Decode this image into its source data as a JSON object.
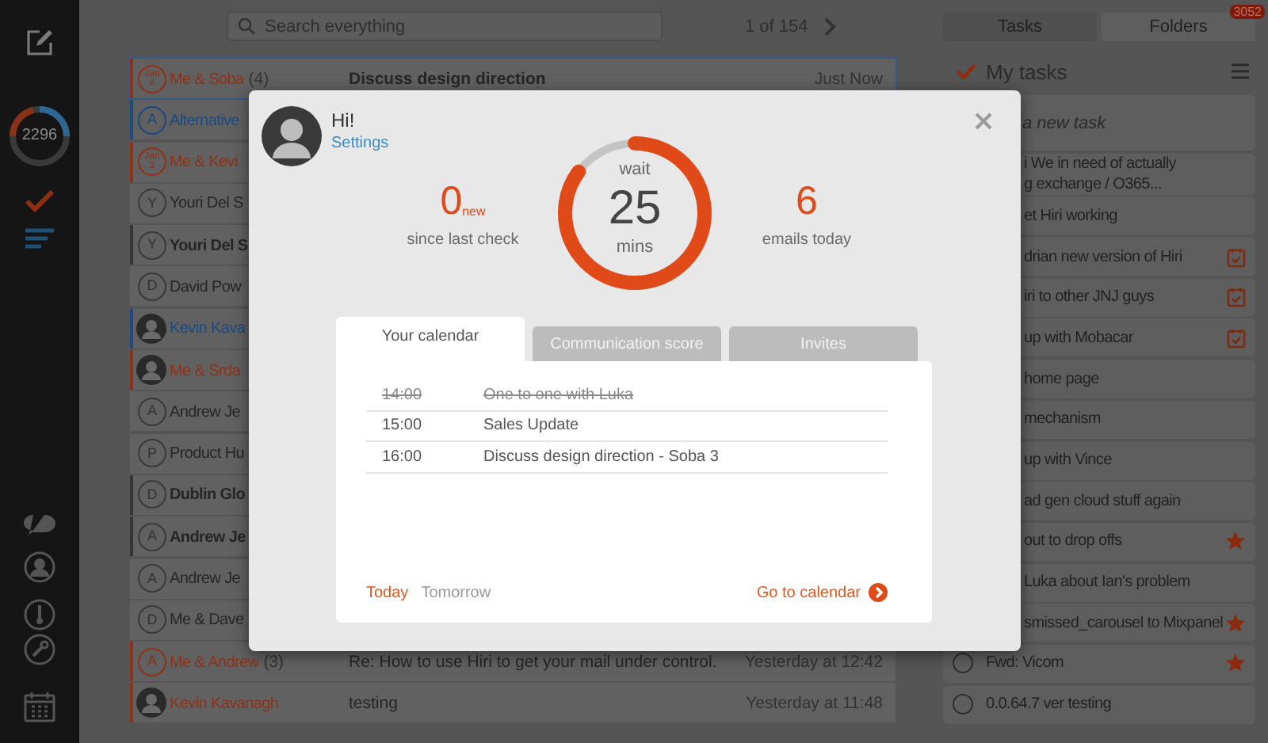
{
  "sidebar": {
    "unread_count": "2296"
  },
  "search": {
    "placeholder": "Search everything"
  },
  "pager": {
    "text": "1 of 154"
  },
  "messages": [
    {
      "avatar": {
        "kind": "date",
        "month": "Jan",
        "day": "4"
      },
      "sender": "Me & Soba",
      "count": "(4)",
      "subject": "Discuss design direction",
      "time": "Just Now",
      "color": "#8f3218",
      "unread": false,
      "selected": true
    },
    {
      "avatar": {
        "kind": "letter",
        "letter": "A"
      },
      "sender": "Alternative",
      "color": "#1b4a80",
      "unread": false,
      "selected": false
    },
    {
      "avatar": {
        "kind": "date",
        "month": "Jan",
        "day": "3"
      },
      "sender": "Me & Kevi",
      "color": "#8f3218",
      "unread": false,
      "selected": false
    },
    {
      "avatar": {
        "kind": "letter",
        "letter": "Y"
      },
      "sender": "Youri Del S",
      "unread": false,
      "selected": false
    },
    {
      "avatar": {
        "kind": "letter",
        "letter": "Y"
      },
      "sender": "Youri Del S",
      "unread": true,
      "selected": false
    },
    {
      "avatar": {
        "kind": "letter",
        "letter": "D"
      },
      "sender": "David Pow",
      "unread": false,
      "selected": false
    },
    {
      "avatar": {
        "kind": "photo"
      },
      "sender": "Kevin Kava",
      "color": "#1b4a80",
      "unread": false,
      "selected": false
    },
    {
      "avatar": {
        "kind": "photo"
      },
      "sender": "Me & Srda",
      "color": "#8f3218",
      "unread": false,
      "selected": false
    },
    {
      "avatar": {
        "kind": "letter",
        "letter": "A"
      },
      "sender": "Andrew Je",
      "unread": false,
      "selected": false
    },
    {
      "avatar": {
        "kind": "letter",
        "letter": "P"
      },
      "sender": "Product Hu",
      "unread": false,
      "selected": false
    },
    {
      "avatar": {
        "kind": "letter",
        "letter": "D"
      },
      "sender": "Dublin Glo",
      "unread": true,
      "selected": false
    },
    {
      "avatar": {
        "kind": "letter",
        "letter": "A"
      },
      "sender": "Andrew Je",
      "unread": true,
      "selected": false
    },
    {
      "avatar": {
        "kind": "letter",
        "letter": "A"
      },
      "sender": "Andrew Je",
      "unread": false,
      "selected": false
    },
    {
      "avatar": {
        "kind": "letter",
        "letter": "D"
      },
      "sender": "Me & Dave",
      "unread": false,
      "selected": false
    },
    {
      "avatar": {
        "kind": "letter",
        "letter": "A"
      },
      "sender": "Me & Andrew",
      "count": "(3)",
      "subject": "Re: How to use Hiri to get your mail under control.",
      "time": "Yesterday at 12:42",
      "color": "#8f3218",
      "unread": false,
      "selected": false
    },
    {
      "avatar": {
        "kind": "photo"
      },
      "sender": "Kevin Kavanagh",
      "subject": "testing",
      "time": "Yesterday at 11:48",
      "color": "#8f3218",
      "unread": false,
      "selected": false
    }
  ],
  "side_tabs": [
    {
      "label": "Tasks",
      "selected": true
    },
    {
      "label": "Folders",
      "selected": false,
      "badge": "3052"
    }
  ],
  "tasks_header": {
    "title": "My tasks"
  },
  "new_task": {
    "placeholder": "a new task"
  },
  "tasks": [
    {
      "kind": "covered",
      "text": "i We in need of actually\ng exchange / O365...",
      "starred": false,
      "has_event": false
    },
    {
      "kind": "covered",
      "text": "et Hiri working",
      "starred": false,
      "has_event": false
    },
    {
      "kind": "covered",
      "text": "drian new version of Hiri",
      "starred": false,
      "has_event": true
    },
    {
      "kind": "covered",
      "text": "iri to other JNJ guys",
      "starred": false,
      "has_event": true
    },
    {
      "kind": "covered",
      "text": "up with Mobacar",
      "starred": false,
      "has_event": true
    },
    {
      "kind": "covered",
      "text": "home page",
      "starred": false,
      "has_event": false
    },
    {
      "kind": "covered",
      "text": "mechanism",
      "starred": false,
      "has_event": false
    },
    {
      "kind": "covered",
      "text": "up with Vince",
      "starred": false,
      "has_event": false
    },
    {
      "kind": "covered",
      "text": "ad gen cloud stuff again",
      "starred": false,
      "has_event": false
    },
    {
      "kind": "covered",
      "text": "out to drop offs",
      "starred": true,
      "has_event": false
    },
    {
      "kind": "covered",
      "text": "Luka about Ian's problem",
      "starred": false,
      "has_event": false
    },
    {
      "kind": "covered",
      "text": "smissed_carousel to Mixpanel",
      "starred": true,
      "has_event": false
    },
    {
      "kind": "plain",
      "text": "Fwd: Vicom",
      "starred": true,
      "has_event": false,
      "checked": false
    },
    {
      "kind": "plain",
      "text": "0.0.64.7 ver testing",
      "starred": false,
      "has_event": false,
      "checked": false
    }
  ],
  "dialog": {
    "greeting": "Hi!",
    "settings_link": "Settings",
    "stats": {
      "new_count": "0",
      "new_label": "new",
      "new_caption": "since last check",
      "wait_label": "wait",
      "wait_value": "25",
      "wait_unit": "mins",
      "level": 0.85,
      "today_count": "6",
      "today_caption": "emails today"
    },
    "tabs": [
      {
        "label": "Your calendar",
        "selected": true
      },
      {
        "label": "Communication score",
        "selected": false
      },
      {
        "label": "Invites",
        "selected": false
      }
    ],
    "events": [
      {
        "time": "14:00",
        "title": "One to one with Luka",
        "done": true
      },
      {
        "time": "15:00",
        "title": "Sales Update",
        "done": false
      },
      {
        "time": "16:00",
        "title": "Discuss design direction - Soba 3",
        "done": false
      }
    ],
    "days": [
      {
        "label": "Today",
        "selected": true
      },
      {
        "label": "Tomorrow",
        "selected": false
      }
    ],
    "calendar_link": "Go to calendar"
  }
}
